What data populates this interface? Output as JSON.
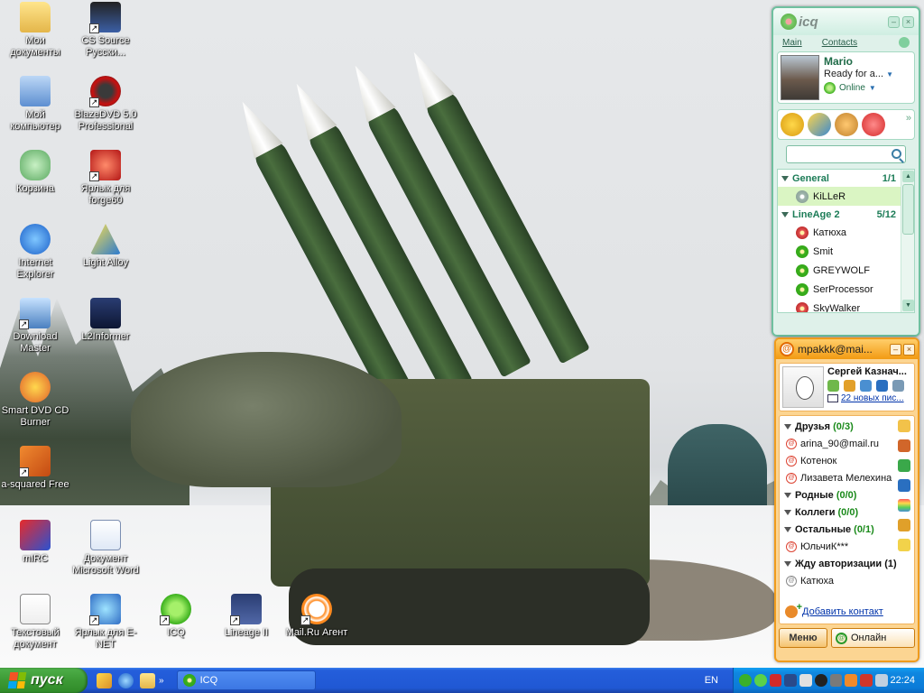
{
  "desktop": {
    "icons": [
      {
        "label": "Мои документы"
      },
      {
        "label": "Мой компьютер"
      },
      {
        "label": "Корзина"
      },
      {
        "label": "Internet Explorer"
      },
      {
        "label": "Download Master"
      },
      {
        "label": "Smart DVD CD Burner"
      },
      {
        "label": "a-squared Free"
      },
      {
        "label": "mIRC"
      },
      {
        "label": "Текстовый документ"
      },
      {
        "label": "CS Source Русски..."
      },
      {
        "label": "BlazeDVD 5.0 Professional"
      },
      {
        "label": "Ярлык для forge60"
      },
      {
        "label": "Light Alloy"
      },
      {
        "label": "L2Informer"
      },
      {
        "label": "Документ Microsoft Word"
      },
      {
        "label": "Ярлык для E-NET"
      },
      {
        "label": "ICQ"
      },
      {
        "label": "Lineage II"
      },
      {
        "label": "Mail.Ru Агент"
      }
    ]
  },
  "icq": {
    "title": "icq",
    "tabs": {
      "main": "Main",
      "contacts": "Contacts"
    },
    "user": {
      "name": "Mario",
      "status_message": "Ready for a...",
      "status": "Online"
    },
    "search": {
      "placeholder": ""
    },
    "groups": [
      {
        "name": "General",
        "count": "1/1",
        "contacts": [
          {
            "name": "KiLLeR"
          }
        ]
      },
      {
        "name": "LineAge 2",
        "count": "5/12",
        "contacts": [
          {
            "name": "Катюха"
          },
          {
            "name": "Smit"
          },
          {
            "name": "GREYWOLF"
          },
          {
            "name": "SerProcessor"
          },
          {
            "name": "SkyWalker"
          }
        ]
      }
    ]
  },
  "mra": {
    "title": "mpakkk@mai...",
    "user": {
      "name": "Сергей Казнач...",
      "new_mail": "22 новых пис..."
    },
    "list": [
      {
        "type": "group",
        "name": "Друзья",
        "num": "(0/3)"
      },
      {
        "type": "contact",
        "name": "arina_90@mail.ru"
      },
      {
        "type": "contact",
        "name": "Котенок"
      },
      {
        "type": "contact",
        "name": "Лизавета Мелехина"
      },
      {
        "type": "group",
        "name": "Родные",
        "num": "(0/0)"
      },
      {
        "type": "group",
        "name": "Коллеги",
        "num": "(0/0)"
      },
      {
        "type": "group",
        "name": "Остальные",
        "num": "(0/1)"
      },
      {
        "type": "contact",
        "name": "ЮльчиК***"
      },
      {
        "type": "group",
        "name": "Жду авторизации",
        "num": "(1)"
      },
      {
        "type": "contact",
        "name": "Катюха"
      }
    ],
    "add_contact": "Добавить контакт",
    "menu_button": "Меню",
    "status_button": "Онлайн"
  },
  "taskbar": {
    "start_label": "пуск",
    "task_button": "ICQ",
    "language": "EN",
    "clock": "22:24"
  },
  "colors": {
    "icq_accent": "#1c7c57",
    "mra_accent": "#ef9b1c",
    "taskbar": "#245edb",
    "start": "#3c9a35"
  }
}
